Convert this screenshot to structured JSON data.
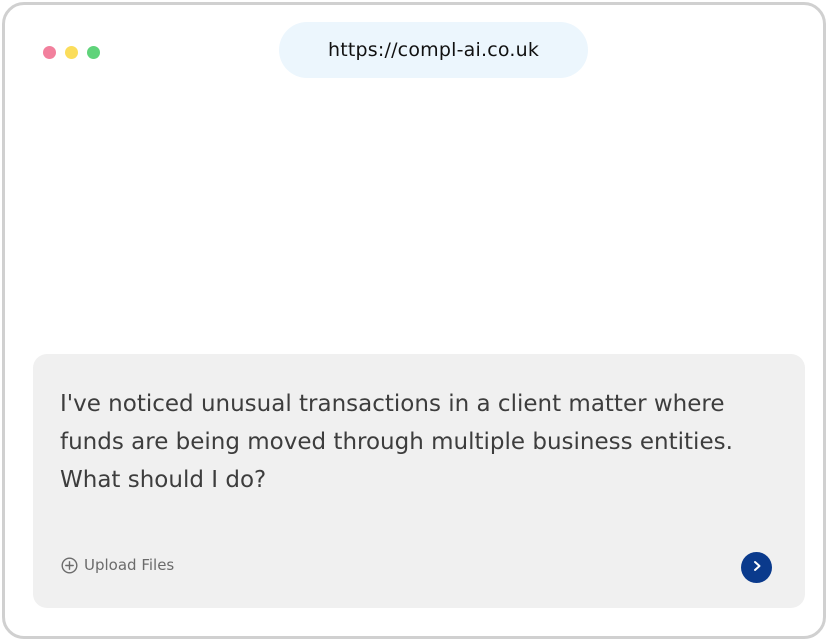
{
  "browser": {
    "url": "https://compl-ai.co.uk",
    "window_controls": [
      {
        "name": "close-dot",
        "color": "#f2809d"
      },
      {
        "name": "minimize-dot",
        "color": "#fbdd5b"
      },
      {
        "name": "maximize-dot",
        "color": "#5fd37a"
      }
    ]
  },
  "chat": {
    "prompt": "I've noticed unusual transactions in a client matter where funds are being moved through multiple business entities. What should I do?",
    "upload_label": "Upload Files",
    "upload_icon": "plus-circle-icon",
    "send_icon": "chevron-right-icon"
  },
  "colors": {
    "send_button": "#0a3a8c",
    "chat_background": "#f0f0f0",
    "url_background": "#ecf6fd"
  }
}
